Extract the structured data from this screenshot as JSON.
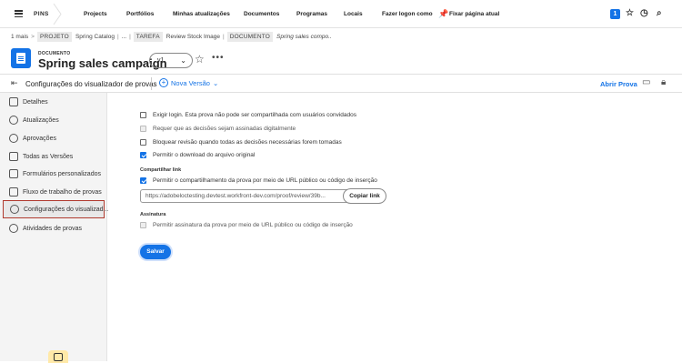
{
  "topbar": {
    "pins_label": "PINS",
    "nav": [
      "Projects",
      "Portfólios",
      "Minhas atualizações",
      "Documentos",
      "Programas",
      "Locais",
      "Fazer logon como"
    ],
    "pin_page_label": "Fixar página atual",
    "badge_count": "1",
    "icons": [
      "menu-icon",
      "pin-icon",
      "star-icon",
      "history-icon",
      "search-icon"
    ]
  },
  "breadcrumb": {
    "more": "1 mais",
    "project_type": "PROJETO",
    "project_name": "Spring Catalog",
    "ellipsis": "...",
    "task_type": "TAREFA",
    "task_name": "Review Stock Image",
    "doc_type": "DOCUMENTO",
    "doc_name": "Spring sales compo.."
  },
  "document": {
    "label": "DOCUMENTO",
    "title": "Spring sales campaign",
    "version": "v1",
    "accent": "#1473e6"
  },
  "toolbar": {
    "title": "Configurações do visualizador de provas",
    "new_version": "Nova Versão",
    "open_proof": "Abrir Prova"
  },
  "sidebar": {
    "items": [
      {
        "label": "Detalhes",
        "icon": "details-icon"
      },
      {
        "label": "Atualizações",
        "icon": "updates-icon"
      },
      {
        "label": "Aprovações",
        "icon": "approvals-icon"
      },
      {
        "label": "Todas as Versões",
        "icon": "versions-icon"
      },
      {
        "label": "Formulários personalizados",
        "icon": "forms-icon"
      },
      {
        "label": "Fluxo de trabalho de provas",
        "icon": "workflow-icon"
      },
      {
        "label": "Configurações do visualizad...",
        "icon": "settings-icon",
        "active": true
      },
      {
        "label": "Atividades de provas",
        "icon": "activity-icon"
      }
    ]
  },
  "settings": {
    "options": [
      {
        "label": "Exigir login. Esta prova não pode ser compartilhada com usuários convidados",
        "checked": false,
        "disabled": false
      },
      {
        "label": "Requer que as decisões sejam assinadas digitalmente",
        "checked": false,
        "disabled": true
      },
      {
        "label": "Bloquear revisão quando todas as decisões necessárias forem tomadas",
        "checked": false,
        "disabled": false
      },
      {
        "label": "Permitir o download do arquivo original",
        "checked": true,
        "disabled": false
      }
    ],
    "share_section": "Compartilhar link",
    "share_option": "Permitir o compartilhamento da prova por meio de URL público ou código de inserção",
    "share_url": "https://adobeloctesting.devtest.workfront-dev.com/proof/review/39b...",
    "copy_link": "Copiar link",
    "signature_section": "Assinatura",
    "signature_option": "Permitir assinatura da prova por meio de URL público ou código de inserção",
    "save": "Salvar"
  }
}
